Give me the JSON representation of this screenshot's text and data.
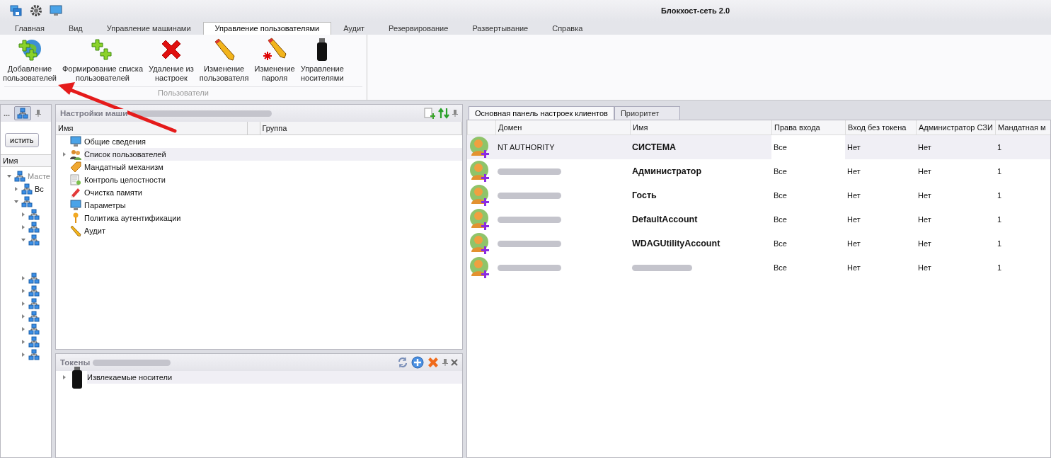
{
  "window": {
    "title": "Блокхост-сеть 2.0"
  },
  "menu_tabs": [
    {
      "label": "Главная",
      "selected": false
    },
    {
      "label": "Вид",
      "selected": false
    },
    {
      "label": "Управление машинами",
      "selected": false
    },
    {
      "label": "Управление пользователями",
      "selected": true
    },
    {
      "label": "Аудит",
      "selected": false
    },
    {
      "label": "Резервирование",
      "selected": false
    },
    {
      "label": "Развертывание",
      "selected": false
    },
    {
      "label": "Справка",
      "selected": false
    }
  ],
  "ribbon": {
    "group": "Пользователи",
    "buttons": [
      {
        "kind": "globe-add",
        "label": "Добавление\nпользователей"
      },
      {
        "kind": "plus-pair",
        "label": "Формирование списка\nпользователей"
      },
      {
        "kind": "cross",
        "label": "Удаление из\nнастроек"
      },
      {
        "kind": "pencil",
        "label": "Изменение\nпользователя"
      },
      {
        "kind": "pencil-star",
        "label": "Изменение\nпароля"
      },
      {
        "kind": "usb",
        "label": "Управление\nносителями"
      }
    ]
  },
  "left_panel": {
    "title": "...",
    "button": "истить",
    "column": "Имя",
    "tree": [
      {
        "label": "Масте",
        "expanded": true,
        "children": [
          {
            "label": "Вс",
            "expanded": false
          },
          {
            "expanded": true,
            "children": [
              {
                "expanded": false
              },
              {
                "expanded": false
              },
              {
                "expanded": true
              },
              {
                "expanded": false
              },
              {
                "expanded": false
              },
              {
                "expanded": false
              },
              {
                "expanded": false
              },
              {
                "expanded": false
              },
              {
                "expanded": false
              },
              {
                "expanded": false
              }
            ]
          }
        ]
      }
    ]
  },
  "settings_panel": {
    "title": "Настройки маши",
    "columns": [
      "Имя",
      "Группа"
    ],
    "items": [
      {
        "kind": "monitor",
        "label": "Общие сведения",
        "selected": false,
        "expandable": false
      },
      {
        "kind": "users",
        "label": "Список пользователей",
        "selected": true,
        "expandable": true
      },
      {
        "kind": "tag",
        "label": "Мандатный механизм",
        "selected": false,
        "expandable": false
      },
      {
        "kind": "checklist",
        "label": "Контроль целостности",
        "selected": false,
        "expandable": false
      },
      {
        "kind": "eraser",
        "label": "Очистка памяти",
        "selected": false,
        "expandable": false
      },
      {
        "kind": "monitor",
        "label": "Параметры",
        "selected": false,
        "expandable": false
      },
      {
        "kind": "key",
        "label": "Политика аутентификации",
        "selected": false,
        "expandable": false
      },
      {
        "kind": "pencil",
        "label": "Аудит",
        "selected": false,
        "expandable": false
      }
    ]
  },
  "tokens_panel": {
    "title": "Токены",
    "items": [
      {
        "label": "Извлекаемые носители",
        "selected": true
      }
    ]
  },
  "client_tabs": [
    {
      "label": "Основная панель настроек клиентов",
      "selected": true
    },
    {
      "label": "Приоритет",
      "selected": false
    }
  ],
  "users_table": {
    "columns": [
      "Домен",
      "Имя",
      "Права входа",
      "Вход без токена",
      "Администратор СЗИ",
      "Мандатная м"
    ],
    "rows": [
      {
        "domain": "NT AUTHORITY",
        "name": "СИСТЕМА",
        "rights": "Все",
        "no_token": "Нет",
        "admin": "Нет",
        "level": "1",
        "selected": true
      },
      {
        "name": "Администратор",
        "rights": "Все",
        "no_token": "Нет",
        "admin": "Нет",
        "level": "1",
        "selected": false
      },
      {
        "name": "Гость",
        "rights": "Все",
        "no_token": "Нет",
        "admin": "Нет",
        "level": "1",
        "selected": false
      },
      {
        "name": "DefaultAccount",
        "rights": "Все",
        "no_token": "Нет",
        "admin": "Нет",
        "level": "1",
        "selected": false
      },
      {
        "name": "WDAGUtilityAccount",
        "rights": "Все",
        "no_token": "Нет",
        "admin": "Нет",
        "level": "1",
        "selected": false
      },
      {
        "rights": "Все",
        "no_token": "Нет",
        "admin": "Нет",
        "level": "1",
        "selected": false
      }
    ]
  }
}
